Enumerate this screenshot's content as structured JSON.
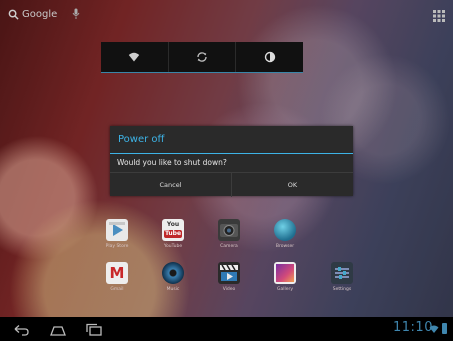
{
  "search": {
    "label": "Google"
  },
  "quick_settings": {
    "icons": [
      "wifi-icon",
      "sync-icon",
      "brightness-icon"
    ]
  },
  "dialog": {
    "title": "Power off",
    "message": "Would you like to shut down?",
    "cancel_label": "Cancel",
    "ok_label": "OK"
  },
  "apps": [
    {
      "label": "Play Store",
      "icon": "play-store-icon"
    },
    {
      "label": "YouTube",
      "icon": "youtube-icon",
      "icon_text": [
        "You",
        "Tube"
      ]
    },
    {
      "label": "Camera",
      "icon": "camera-icon"
    },
    {
      "label": "Browser",
      "icon": "browser-icon"
    },
    {
      "label": "Gmail",
      "icon": "gmail-icon",
      "icon_text": [
        "M"
      ]
    },
    {
      "label": "Music",
      "icon": "music-icon"
    },
    {
      "label": "Video",
      "icon": "video-icon"
    },
    {
      "label": "Gallery",
      "icon": "gallery-icon"
    },
    {
      "label": "Settings",
      "icon": "settings-icon"
    }
  ],
  "status_bar": {
    "time": "11:10"
  },
  "colors": {
    "accent": "#3db3e6",
    "clock": "#3f86ae",
    "dialog_bg": "#2a2a2a"
  }
}
